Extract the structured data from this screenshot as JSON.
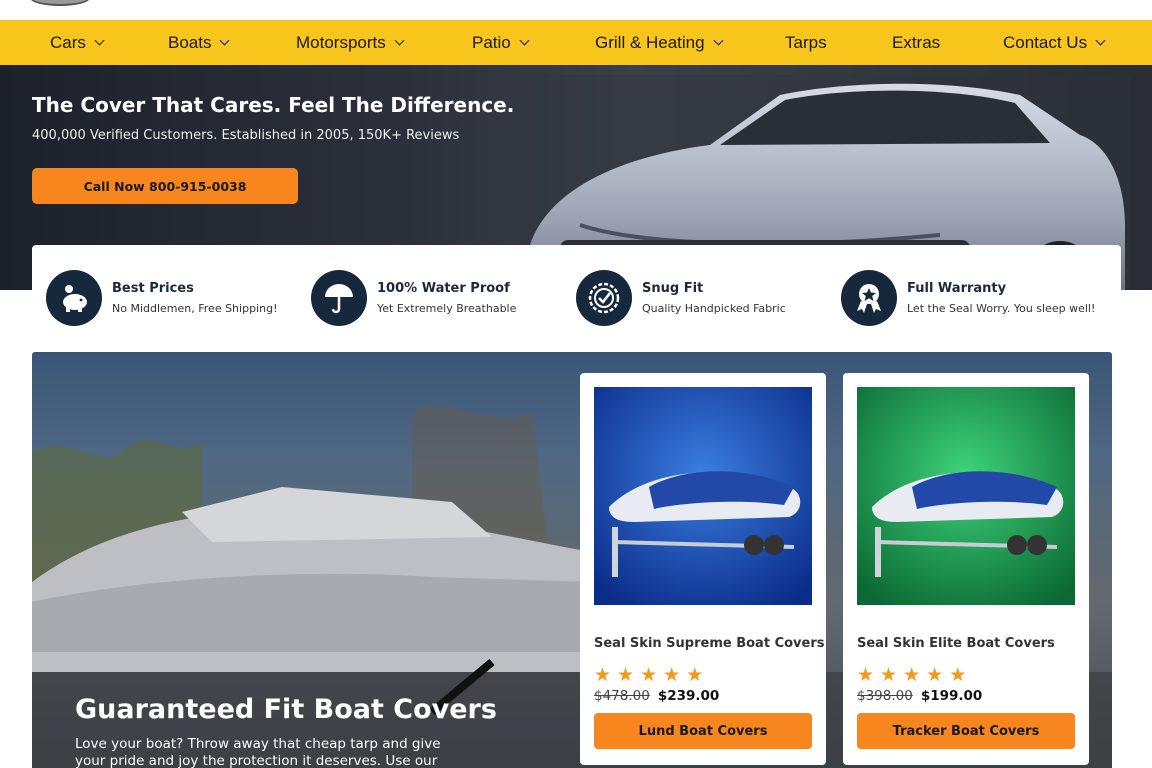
{
  "nav": {
    "items": [
      {
        "label": "Cars",
        "has_dropdown": true
      },
      {
        "label": "Boats",
        "has_dropdown": true
      },
      {
        "label": "Motorsports",
        "has_dropdown": true
      },
      {
        "label": "Patio",
        "has_dropdown": true
      },
      {
        "label": "Grill & Heating",
        "has_dropdown": true
      },
      {
        "label": "Tarps",
        "has_dropdown": false
      },
      {
        "label": "Extras",
        "has_dropdown": false
      },
      {
        "label": "Contact Us",
        "has_dropdown": true
      }
    ]
  },
  "hero": {
    "title": "The Cover That Cares. Feel The Difference.",
    "subtitle": "400,000 Verified Customers. Established in 2005, 150K+ Reviews",
    "cta_label": "Call Now 800-915-0038"
  },
  "features": [
    {
      "icon": "piggy-bank-icon",
      "title": "Best Prices",
      "subtitle": "No Middlemen, Free Shipping!"
    },
    {
      "icon": "umbrella-icon",
      "title": "100% Water Proof",
      "subtitle": "Yet Extremely Breathable"
    },
    {
      "icon": "badge-check-icon",
      "title": "Snug Fit",
      "subtitle": "Quality Handpicked Fabric"
    },
    {
      "icon": "award-ribbon-icon",
      "title": "Full Warranty",
      "subtitle": "Let the Seal Worry. You sleep well!"
    }
  ],
  "boat_section": {
    "title": "Guaranteed Fit Boat Covers",
    "text": "Love your boat? Throw away that cheap tarp and give your pride and joy the protection it deserves. Use our selector to"
  },
  "products": [
    {
      "name": "Seal Skin Supreme Boat Covers",
      "rating": 5,
      "old_price": "$478.00",
      "price": "$239.00",
      "button": "Lund Boat Covers",
      "bg_color": "#1f4fb8"
    },
    {
      "name": "Seal Skin Elite Boat Covers",
      "rating": 5,
      "old_price": "$398.00",
      "price": "$199.00",
      "button": "Tracker Boat Covers",
      "bg_color": "#18a352"
    }
  ],
  "colors": {
    "nav_bg": "#f7c51c",
    "accent_orange": "#f7861e",
    "icon_navy": "#15283c",
    "star": "#f29a1f"
  }
}
